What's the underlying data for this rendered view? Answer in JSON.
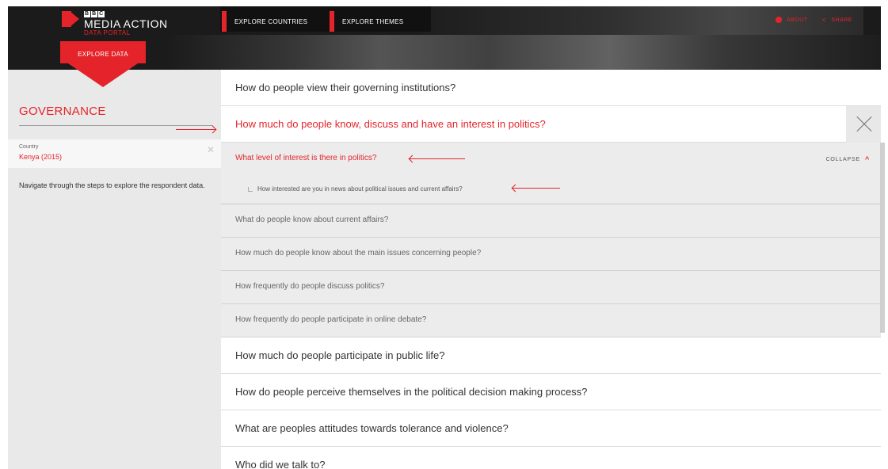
{
  "header": {
    "logo": {
      "bbc": [
        "B",
        "B",
        "C"
      ],
      "name": "MEDIA ACTION",
      "sub": "DATA PORTAL"
    },
    "nav": [
      {
        "label": "EXPLORE COUNTRIES"
      },
      {
        "label": "EXPLORE THEMES"
      }
    ],
    "top_right": [
      {
        "label": "ABOUT",
        "icon": "info-icon"
      },
      {
        "label": "SHARE",
        "icon": "share-icon"
      }
    ],
    "explore_button": "EXPLORE DATA",
    "colors": {
      "accent": "#e4242a",
      "header_bg": "#1b1b1b"
    }
  },
  "sidebar": {
    "title": "GOVERNANCE",
    "country_label": "Country",
    "country_value": "Kenya (2015)",
    "hint": "Navigate through the steps to explore the respondent data."
  },
  "main": {
    "questions": [
      "How do people view their governing institutions?",
      "How much do people know, discuss and have an interest in politics?",
      "How much do people participate in public life?",
      "How do people perceive themselves in the political decision making process?",
      "What are peoples attitudes towards tolerance and violence?",
      "Who did we talk to?"
    ],
    "sub_questions": [
      "What level of interest is there in politics?",
      "What do people know about current affairs?",
      "How much do people know about the main issues concerning people?",
      "How frequently do people discuss politics?",
      "How frequently do people participate in online debate?"
    ],
    "item_question": "How interested are you in news about political issues and current affairs?",
    "collapse_label": "COLLAPSE"
  }
}
